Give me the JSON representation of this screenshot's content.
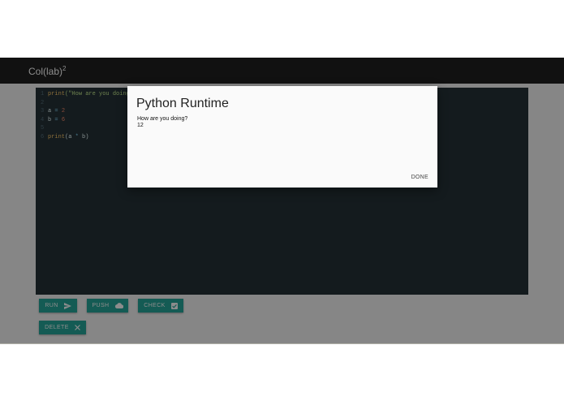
{
  "appbar": {
    "brand": "Col(lab)",
    "brand_superscript": "2"
  },
  "editor": {
    "lines": [
      {
        "number": "1",
        "parts": [
          {
            "t": "print",
            "c": "kw"
          },
          {
            "t": "(\"How are you doing?\")",
            "c": "str"
          }
        ]
      },
      {
        "number": "2",
        "parts": []
      },
      {
        "number": "3",
        "parts": [
          {
            "t": "a",
            "c": "plain"
          },
          {
            "t": " = ",
            "c": "op"
          },
          {
            "t": "2",
            "c": "num"
          }
        ]
      },
      {
        "number": "4",
        "parts": [
          {
            "t": "b",
            "c": "plain"
          },
          {
            "t": " = ",
            "c": "op"
          },
          {
            "t": "6",
            "c": "num"
          }
        ]
      },
      {
        "number": "5",
        "parts": []
      },
      {
        "number": "6",
        "parts": [
          {
            "t": "print",
            "c": "kw"
          },
          {
            "t": "(a ",
            "c": "plain"
          },
          {
            "t": "*",
            "c": "op"
          },
          {
            "t": " b)",
            "c": "plain"
          }
        ]
      }
    ]
  },
  "buttons": {
    "run": {
      "label": "RUN",
      "icon": "send-icon"
    },
    "push": {
      "label": "PUSH",
      "icon": "cloud-icon"
    },
    "check": {
      "label": "CHECK",
      "icon": "checkbox-icon"
    },
    "delete": {
      "label": "DELETE",
      "icon": "close-icon"
    }
  },
  "modal": {
    "title": "Python Runtime",
    "output_lines": [
      "How are you doing?",
      "12"
    ],
    "done_label": "DONE"
  },
  "colors": {
    "appbar": "#202020",
    "editor_bg": "#263238",
    "button": "#26a69a",
    "modal_bg": "#fafafa"
  }
}
